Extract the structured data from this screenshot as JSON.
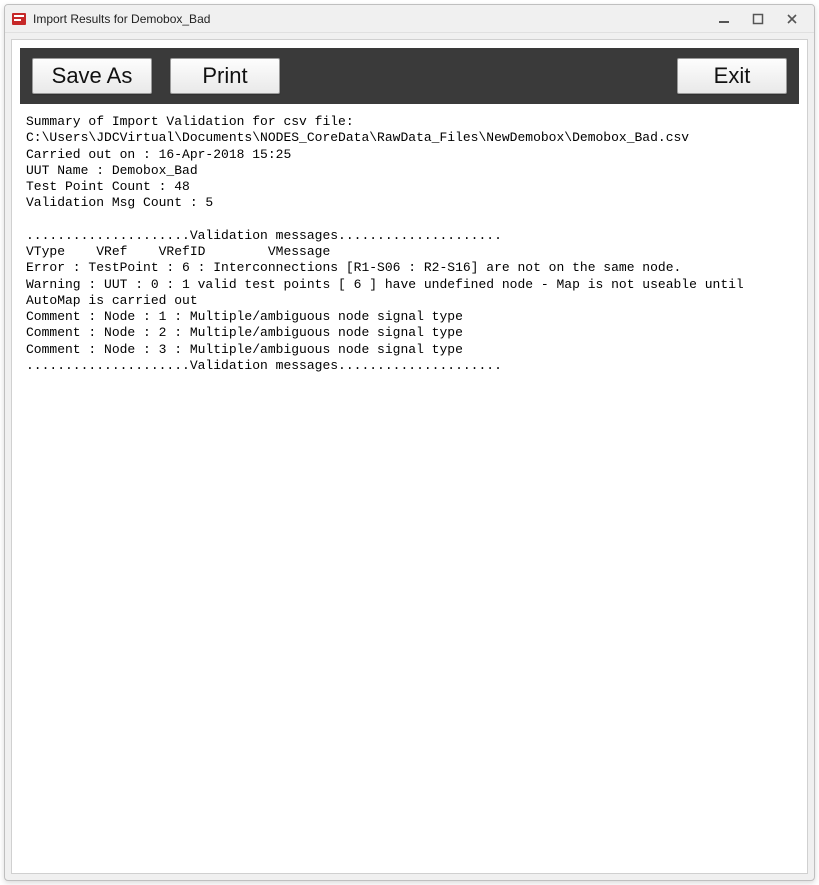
{
  "window": {
    "title": "Import Results for Demobox_Bad"
  },
  "toolbar": {
    "save_as_label": "Save As",
    "print_label": "Print",
    "exit_label": "Exit"
  },
  "log": {
    "text": "Summary of Import Validation for csv file:\nC:\\Users\\JDCVirtual\\Documents\\NODES_CoreData\\RawData_Files\\NewDemobox\\Demobox_Bad.csv\nCarried out on : 16-Apr-2018 15:25\nUUT Name : Demobox_Bad\nTest Point Count : 48\nValidation Msg Count : 5\n\n.....................Validation messages.....................\nVType    VRef    VRefID        VMessage\nError : TestPoint : 6 : Interconnections [R1-S06 : R2-S16] are not on the same node.\nWarning : UUT : 0 : 1 valid test points [ 6 ] have undefined node - Map is not useable until AutoMap is carried out\nComment : Node : 1 : Multiple/ambiguous node signal type\nComment : Node : 2 : Multiple/ambiguous node signal type\nComment : Node : 3 : Multiple/ambiguous node signal type\n.....................Validation messages....................."
  }
}
